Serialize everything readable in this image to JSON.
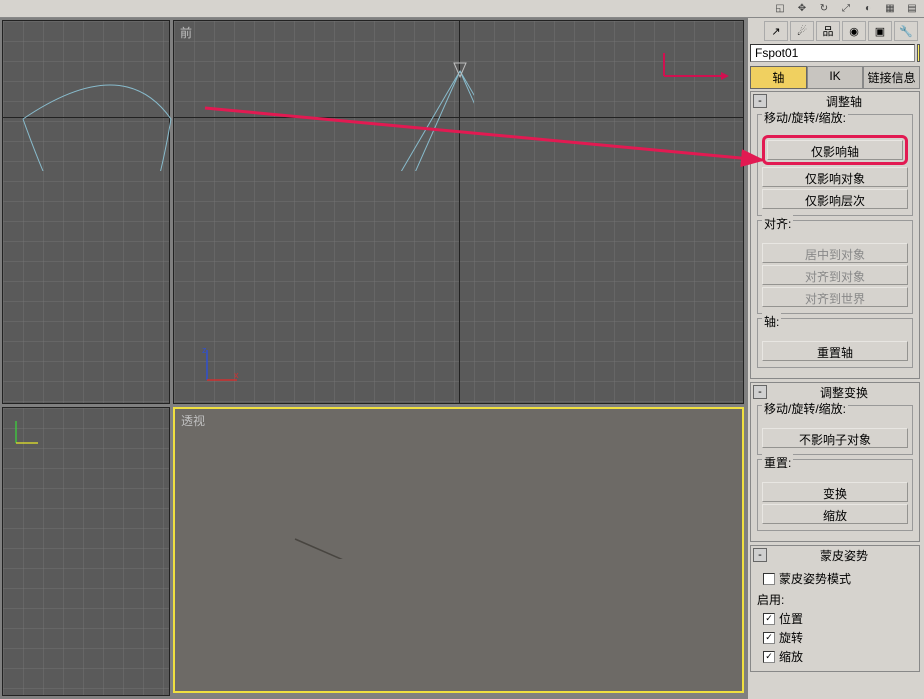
{
  "toolbar": {
    "icons": [
      "curve-icon",
      "link-icon",
      "hierarchy-icon",
      "hammer-icon",
      "display-icon",
      "utility-icon",
      "settings-icon"
    ]
  },
  "viewports": {
    "top_right_label": "前",
    "bottom_right_label": "透视"
  },
  "gizmo": {
    "x": "x",
    "z": "z"
  },
  "object_name": "Fspot01",
  "tabs": {
    "pivot": "轴",
    "ik": "IK",
    "link_info": "链接信息"
  },
  "rollouts": {
    "adjust_pivot": {
      "title": "调整轴",
      "move_rotate_scale": "移动/旋转/缩放:",
      "affect_pivot_only": "仅影响轴",
      "affect_object_only": "仅影响对象",
      "affect_hierarchy_only": "仅影响层次",
      "align_label": "对齐:",
      "center_to_object": "居中到对象",
      "align_to_object": "对齐到对象",
      "align_to_world": "对齐到世界",
      "axis_label": "轴:",
      "reset_axis": "重置轴"
    },
    "adjust_transform": {
      "title": "调整变换",
      "move_rotate_scale": "移动/旋转/缩放:",
      "dont_affect_children": "不影响子对象",
      "reset_label": "重置:",
      "transform": "变换",
      "scale": "缩放"
    },
    "skin_pose": {
      "title": "蒙皮姿势",
      "skin_pose_mode": "蒙皮姿势模式",
      "enable_label": "启用:",
      "position": "位置",
      "rotation": "旋转",
      "scale": "缩放"
    }
  }
}
